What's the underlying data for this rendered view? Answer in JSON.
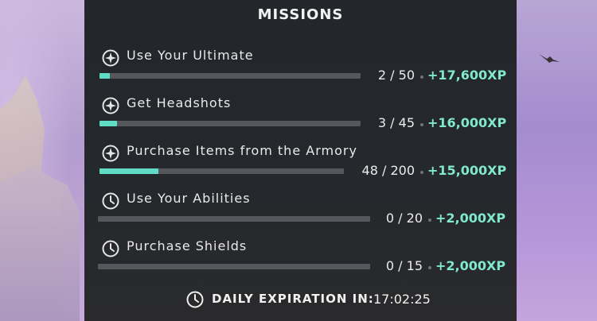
{
  "title": "MISSIONS",
  "colors": {
    "accent": "#7fe8cf",
    "bar_fill": "#5fdcc4",
    "bar_track": "#55575c",
    "panel": "#24272b"
  },
  "missions": [
    {
      "name": "Use Your Ultimate",
      "icon": "ultimate-star-icon",
      "count": "2 / 50",
      "xp": "+17,600XP",
      "progress": 0.04
    },
    {
      "name": "Get Headshots",
      "icon": "ultimate-star-icon",
      "count": "3 / 45",
      "xp": "+16,000XP",
      "progress": 0.067
    },
    {
      "name": "Purchase Items from the Armory",
      "icon": "ultimate-star-icon",
      "count": "48 / 200",
      "xp": "+15,000XP",
      "progress": 0.24
    },
    {
      "name": "Use Your Abilities",
      "icon": "clock-icon",
      "count": "0 / 20",
      "xp": "+2,000XP",
      "progress": 0
    },
    {
      "name": "Purchase Shields",
      "icon": "clock-icon",
      "count": "0 / 15",
      "xp": "+2,000XP",
      "progress": 0
    }
  ],
  "expiration": {
    "label": "DAILY EXPIRATION IN:",
    "time": "17:02:25",
    "icon": "clock-icon"
  }
}
